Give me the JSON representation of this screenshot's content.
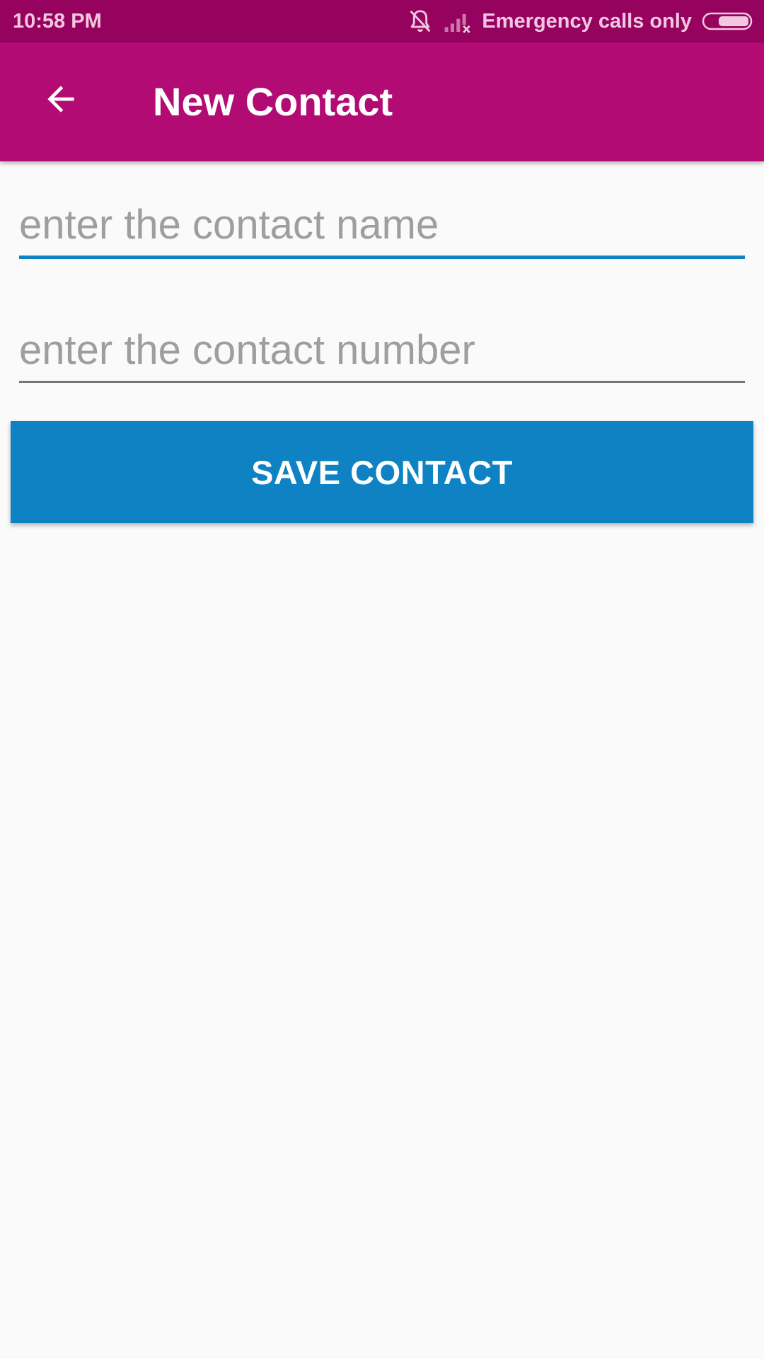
{
  "status_bar": {
    "time": "10:58 PM",
    "carrier": "Emergency calls only",
    "icons": [
      "alarm-off-icon",
      "no-signal-icon",
      "battery-icon"
    ]
  },
  "app_bar": {
    "title": "New Contact",
    "back_icon": "arrow-left-icon"
  },
  "form": {
    "name_placeholder": "enter the contact name",
    "name_value": "",
    "number_placeholder": "enter the contact number",
    "number_value": "",
    "save_label": "SAVE CONTACT"
  },
  "colors": {
    "status_bar": "#95035f",
    "app_bar": "#b20c74",
    "accent": "#0f82c3",
    "background": "#fafafa"
  }
}
